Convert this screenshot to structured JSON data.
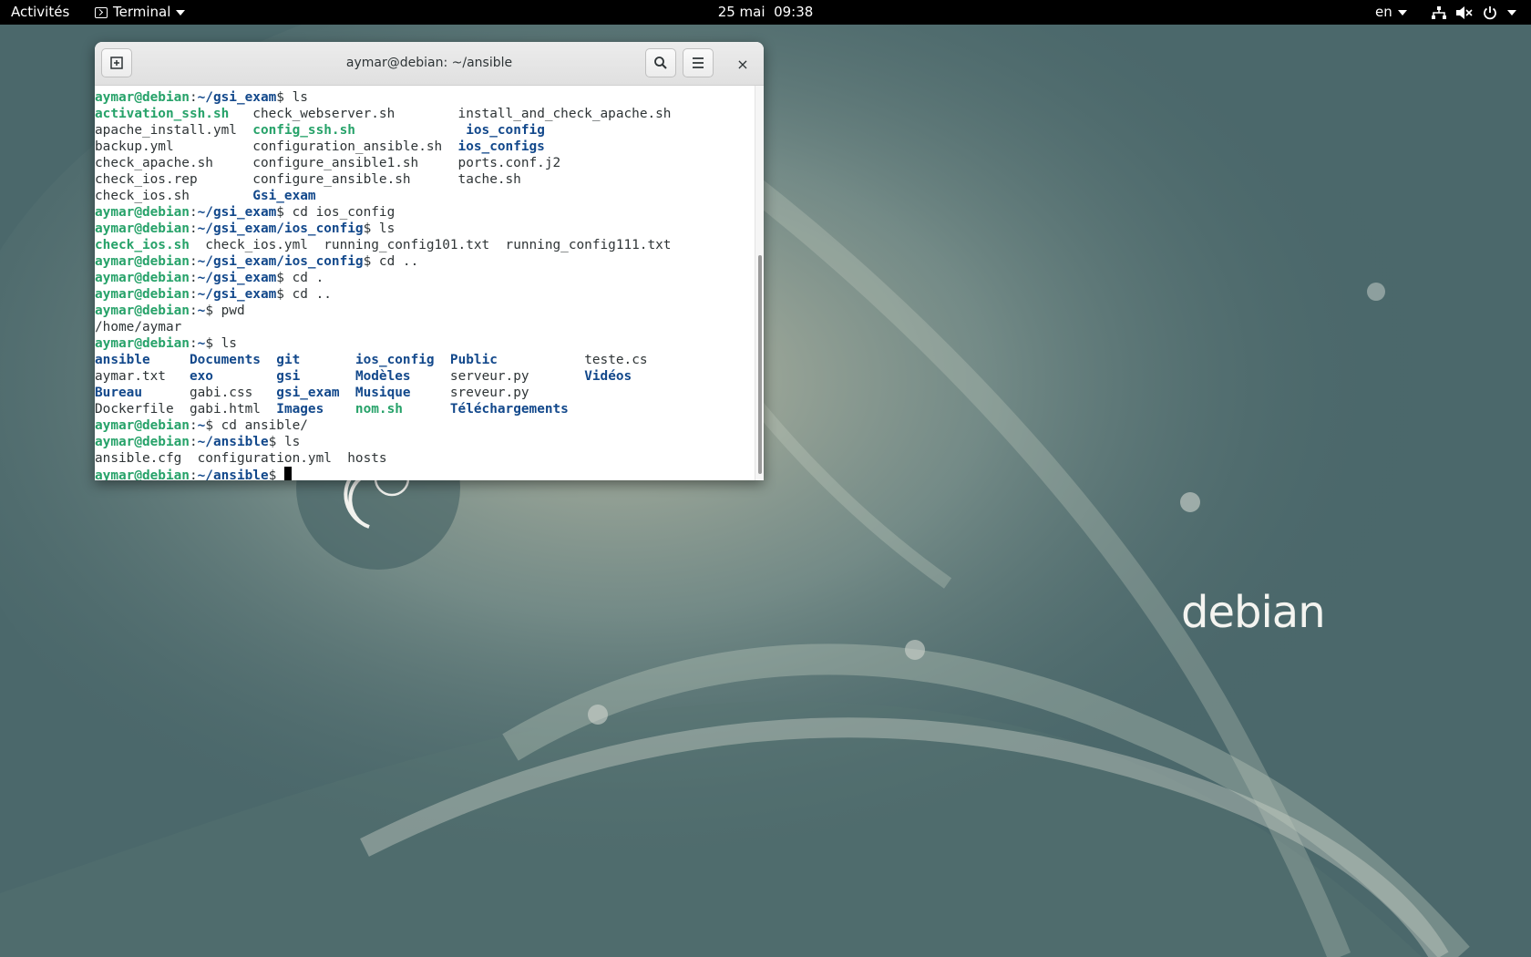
{
  "topbar": {
    "activities": "Activités",
    "app_name": "Terminal",
    "date": "25 mai",
    "time": "09:38",
    "lang": "en"
  },
  "window": {
    "title": "aymar@debian: ~/ansible",
    "close_glyph": "×"
  },
  "terminal_lines": [
    [
      {
        "t": "aymar@debian",
        "c": "g"
      },
      {
        "t": ":",
        "c": ""
      },
      {
        "t": "~/gsi_exam",
        "c": "b"
      },
      {
        "t": "$ ls",
        "c": ""
      }
    ],
    [
      {
        "t": "activation_ssh.sh",
        "c": "x"
      },
      {
        "t": "   check_webserver.sh        install_and_check_apache.sh",
        "c": ""
      }
    ],
    [
      {
        "t": "apache_install.yml  ",
        "c": ""
      },
      {
        "t": "config_ssh.sh",
        "c": "x"
      },
      {
        "t": "              ",
        "c": ""
      },
      {
        "t": "ios_config",
        "c": "b"
      }
    ],
    [
      {
        "t": "backup.yml          configuration_ansible.sh  ",
        "c": ""
      },
      {
        "t": "ios_configs",
        "c": "b"
      }
    ],
    [
      {
        "t": "check_apache.sh     configure_ansible1.sh     ports.conf.j2",
        "c": ""
      }
    ],
    [
      {
        "t": "check_ios.rep       configure_ansible.sh      tache.sh",
        "c": ""
      }
    ],
    [
      {
        "t": "check_ios.sh        ",
        "c": ""
      },
      {
        "t": "Gsi_exam",
        "c": "b"
      }
    ],
    [
      {
        "t": "aymar@debian",
        "c": "g"
      },
      {
        "t": ":",
        "c": ""
      },
      {
        "t": "~/gsi_exam",
        "c": "b"
      },
      {
        "t": "$ cd ios_config",
        "c": ""
      }
    ],
    [
      {
        "t": "aymar@debian",
        "c": "g"
      },
      {
        "t": ":",
        "c": ""
      },
      {
        "t": "~/gsi_exam/ios_config",
        "c": "b"
      },
      {
        "t": "$ ls",
        "c": ""
      }
    ],
    [
      {
        "t": "check_ios.sh",
        "c": "x"
      },
      {
        "t": "  check_ios.yml  running_config101.txt  running_config111.txt",
        "c": ""
      }
    ],
    [
      {
        "t": "aymar@debian",
        "c": "g"
      },
      {
        "t": ":",
        "c": ""
      },
      {
        "t": "~/gsi_exam/ios_config",
        "c": "b"
      },
      {
        "t": "$ cd ..",
        "c": ""
      }
    ],
    [
      {
        "t": "aymar@debian",
        "c": "g"
      },
      {
        "t": ":",
        "c": ""
      },
      {
        "t": "~/gsi_exam",
        "c": "b"
      },
      {
        "t": "$ cd .",
        "c": ""
      }
    ],
    [
      {
        "t": "aymar@debian",
        "c": "g"
      },
      {
        "t": ":",
        "c": ""
      },
      {
        "t": "~/gsi_exam",
        "c": "b"
      },
      {
        "t": "$ cd ..",
        "c": ""
      }
    ],
    [
      {
        "t": "aymar@debian",
        "c": "g"
      },
      {
        "t": ":",
        "c": ""
      },
      {
        "t": "~",
        "c": "b"
      },
      {
        "t": "$ pwd",
        "c": ""
      }
    ],
    [
      {
        "t": "/home/aymar",
        "c": ""
      }
    ],
    [
      {
        "t": "aymar@debian",
        "c": "g"
      },
      {
        "t": ":",
        "c": ""
      },
      {
        "t": "~",
        "c": "b"
      },
      {
        "t": "$ ls",
        "c": ""
      }
    ],
    [
      {
        "t": "ansible",
        "c": "b"
      },
      {
        "t": "     ",
        "c": ""
      },
      {
        "t": "Documents",
        "c": "b"
      },
      {
        "t": "  ",
        "c": ""
      },
      {
        "t": "git",
        "c": "b"
      },
      {
        "t": "       ",
        "c": ""
      },
      {
        "t": "ios_config",
        "c": "b"
      },
      {
        "t": "  ",
        "c": ""
      },
      {
        "t": "Public",
        "c": "b"
      },
      {
        "t": "           teste.cs",
        "c": ""
      }
    ],
    [
      {
        "t": "aymar.txt   ",
        "c": ""
      },
      {
        "t": "exo",
        "c": "b"
      },
      {
        "t": "        ",
        "c": ""
      },
      {
        "t": "gsi",
        "c": "b"
      },
      {
        "t": "       ",
        "c": ""
      },
      {
        "t": "Modèles",
        "c": "b"
      },
      {
        "t": "     serveur.py       ",
        "c": ""
      },
      {
        "t": "Vidéos",
        "c": "b"
      }
    ],
    [
      {
        "t": "Bureau",
        "c": "b"
      },
      {
        "t": "      gabi.css   ",
        "c": ""
      },
      {
        "t": "gsi_exam",
        "c": "b"
      },
      {
        "t": "  ",
        "c": ""
      },
      {
        "t": "Musique",
        "c": "b"
      },
      {
        "t": "     sreveur.py",
        "c": ""
      }
    ],
    [
      {
        "t": "Dockerfile  gabi.html  ",
        "c": ""
      },
      {
        "t": "Images",
        "c": "b"
      },
      {
        "t": "    ",
        "c": ""
      },
      {
        "t": "nom.sh",
        "c": "x"
      },
      {
        "t": "      ",
        "c": ""
      },
      {
        "t": "Téléchargements",
        "c": "b"
      }
    ],
    [
      {
        "t": "aymar@debian",
        "c": "g"
      },
      {
        "t": ":",
        "c": ""
      },
      {
        "t": "~",
        "c": "b"
      },
      {
        "t": "$ cd ansible/",
        "c": ""
      }
    ],
    [
      {
        "t": "aymar@debian",
        "c": "g"
      },
      {
        "t": ":",
        "c": ""
      },
      {
        "t": "~/ansible",
        "c": "b"
      },
      {
        "t": "$ ls",
        "c": ""
      }
    ],
    [
      {
        "t": "ansible.cfg  configuration.yml  hosts",
        "c": ""
      }
    ],
    [
      {
        "t": "aymar@debian",
        "c": "g"
      },
      {
        "t": ":",
        "c": ""
      },
      {
        "t": "~/ansible",
        "c": "b"
      },
      {
        "t": "$ ",
        "c": ""
      }
    ]
  ],
  "desktop": {
    "logo_text": "debian"
  },
  "colors": {
    "prompt_user": "#26a269",
    "prompt_path": "#12488b",
    "directory": "#12488b",
    "executable": "#26a269",
    "topbar_bg": "#000000"
  },
  "icons": {
    "app_menu": "terminal-icon",
    "new_tab": "new-tab-icon",
    "search": "search-icon",
    "menu": "hamburger-menu-icon",
    "close": "close-icon",
    "network": "network-icon",
    "volume": "volume-muted-icon",
    "power": "power-icon"
  }
}
